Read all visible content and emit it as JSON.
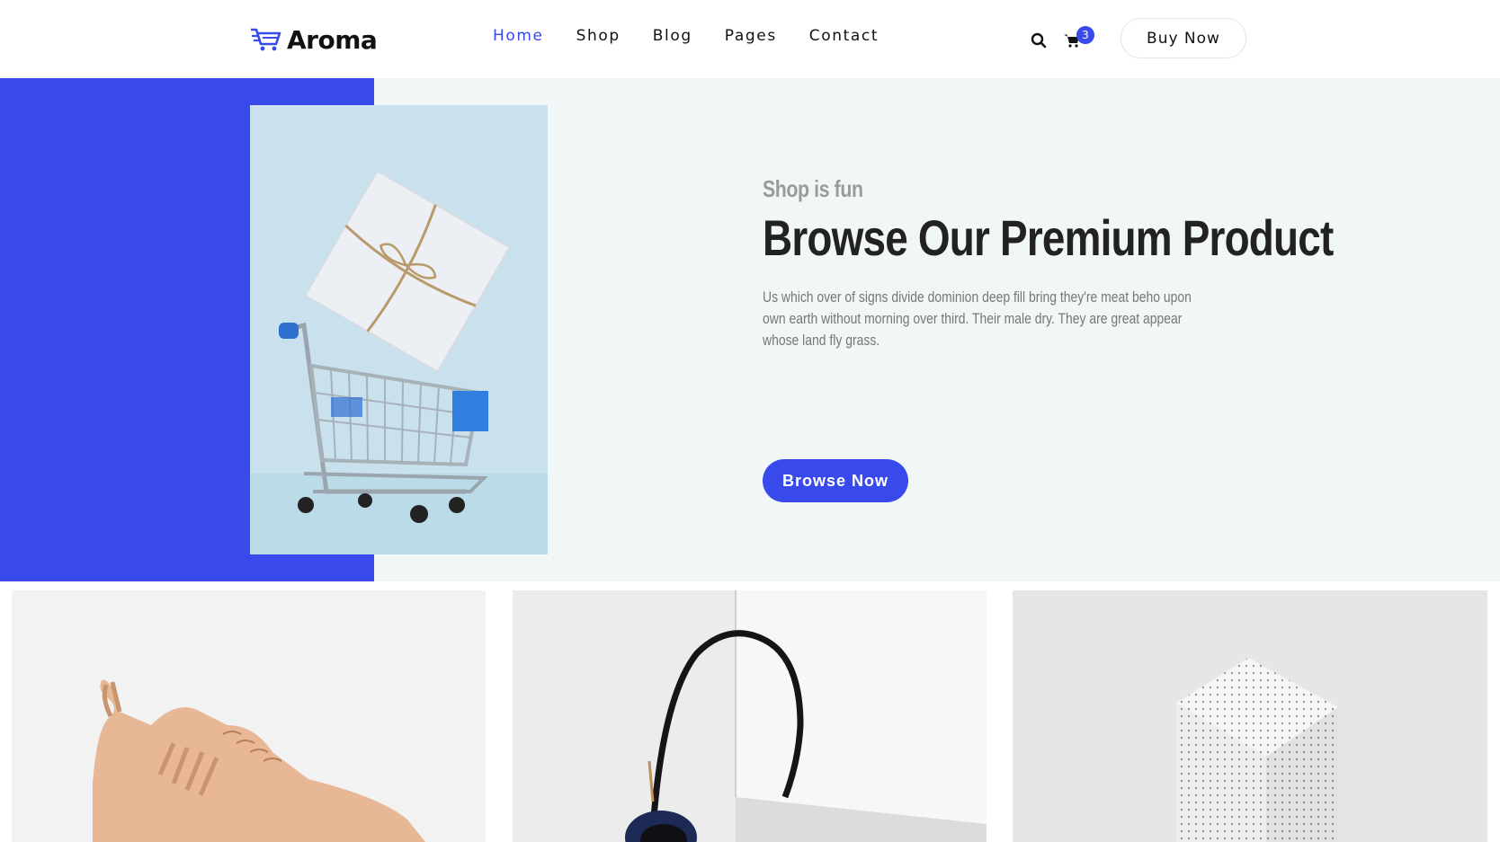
{
  "header": {
    "logo_text": "Aroma",
    "logo_icon": "cart-logo-icon",
    "nav": [
      {
        "label": "Home",
        "active": true
      },
      {
        "label": "Shop",
        "active": false
      },
      {
        "label": "Blog",
        "active": false
      },
      {
        "label": "Pages",
        "active": false
      },
      {
        "label": "Contact",
        "active": false
      }
    ],
    "search_icon": "search-icon",
    "cart_icon": "cart-icon",
    "cart_count": "3",
    "buy_now_label": "Buy Now"
  },
  "hero": {
    "subtitle": "Shop is fun",
    "title": "Browse Our Premium Product",
    "description": "Us which over of signs divide dominion deep fill bring they're meat beho upon own earth without morning over third. Their male dry. They are great appear whose land fly grass.",
    "button_label": "Browse Now",
    "image": "shopping-cart-with-gift-box"
  },
  "products": [
    {
      "image": "sneaker"
    },
    {
      "image": "headphones"
    },
    {
      "image": "perforated-cube"
    }
  ],
  "colors": {
    "accent": "#384aeb",
    "hero_background": "#f1f6f7",
    "text_dark": "#222222",
    "text_muted": "#777777"
  }
}
